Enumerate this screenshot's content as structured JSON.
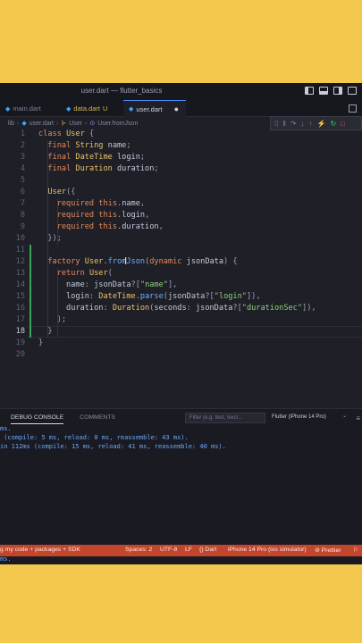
{
  "window": {
    "title": "user.dart — flutter_basics"
  },
  "tabs": [
    {
      "label": "main.dart",
      "active": false,
      "modified": ""
    },
    {
      "label": "data.dart",
      "active": false,
      "modified": "U"
    },
    {
      "label": "user.dart",
      "active": true,
      "modified": "●"
    }
  ],
  "breadcrumb": {
    "lib": "lib",
    "file": "user.dart",
    "class": "User",
    "method": "User.fromJson"
  },
  "code": {
    "line_numbers": [
      "1",
      "2",
      "3",
      "4",
      "5",
      "6",
      "7",
      "8",
      "9",
      "10",
      "11",
      "12",
      "13",
      "14",
      "15",
      "16",
      "17",
      "18",
      "19",
      "20"
    ],
    "lines": [
      "class User {",
      "  final String name;",
      "  final DateTime login;",
      "  final Duration duration;",
      "",
      "  User({",
      "    required this.name,",
      "    required this.login,",
      "    required this.duration,",
      "  });",
      "",
      "  factory User.fromJson(dynamic jsonData) {",
      "    return User(",
      "      name: jsonData?[\"name\"],",
      "      login: DateTime.parse(jsonData?[\"login\"]),",
      "      duration: Duration(seconds: jsonData?[\"durationSec\"]),",
      "    );",
      "  }",
      "}",
      ""
    ],
    "current_line": 18
  },
  "panel": {
    "tabs": [
      "DEBUG CONSOLE",
      "COMMENTS"
    ],
    "filter_placeholder": "Filter (e.g. text, !excl...",
    "device": "Flutter (iPhone 14 Pro)",
    "console": [
      "ms.",
      " (compile: 5 ms, reload: 0 ms, reassemble: 43 ms).",
      "in 112ms (compile: 15 ms, reload: 41 ms, reassemble: 40 ms)."
    ]
  },
  "statusbar": {
    "left": "g my code + packages + SDK",
    "spaces": "Spaces: 2",
    "encoding": "UTF-8",
    "eol": "LF",
    "language": "{} Dart",
    "device": "iPhone 14 Pro (ios simulator)",
    "prettier": "⊘ Prettier"
  },
  "below_status": "ms.",
  "colors": {
    "background": "#f2c94c",
    "statusbar": "#c3462c",
    "editor": "#1e1f27"
  }
}
